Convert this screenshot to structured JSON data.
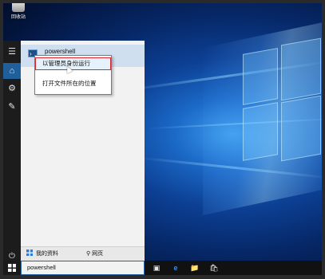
{
  "desktop": {
    "recycle_bin_label": "回收站"
  },
  "start_menu": {
    "best_match": {
      "name": "powershell",
      "icon": "powershell-icon"
    },
    "context_menu": {
      "items": [
        {
          "label": "以管理员身份运行",
          "highlighted": true
        },
        {
          "label": "打开文件所在的位置",
          "highlighted": false
        }
      ]
    },
    "scope": {
      "my_stuff": "我的资料",
      "web": "网页"
    },
    "rail_icons": [
      "hamburger-icon",
      "home-icon",
      "settings-icon",
      "feedback-icon",
      "power-icon"
    ]
  },
  "taskbar": {
    "search_text": "powershell",
    "icons": [
      "task-view-icon",
      "edge-icon",
      "file-explorer-icon",
      "store-icon"
    ]
  },
  "colors": {
    "accent": "#1f5f9a",
    "highlight_border": "#d8282f",
    "taskbar": "#111111"
  }
}
